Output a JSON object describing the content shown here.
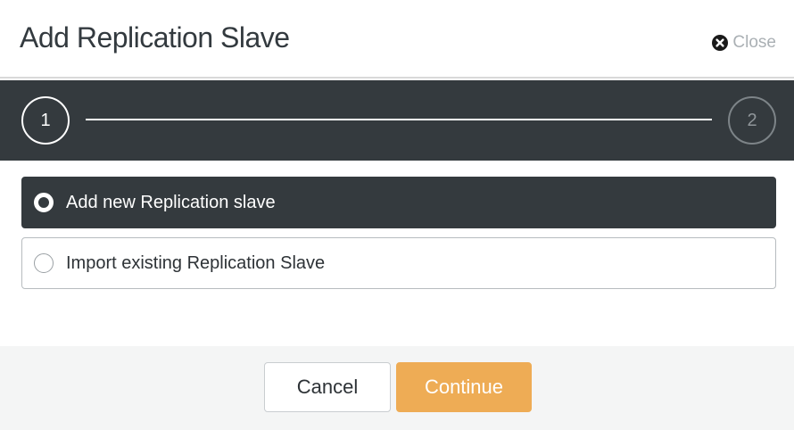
{
  "dialog": {
    "title": "Add Replication Slave",
    "close_label": "Close",
    "close_icon": "close-circle-icon"
  },
  "stepper": {
    "steps": [
      {
        "label": "1",
        "state": "active"
      },
      {
        "label": "2",
        "state": "inactive"
      }
    ]
  },
  "options": [
    {
      "label": "Add new Replication slave",
      "selected": true
    },
    {
      "label": "Import existing Replication Slave",
      "selected": false
    }
  ],
  "footer": {
    "cancel_label": "Cancel",
    "continue_label": "Continue"
  },
  "colors": {
    "dark": "#343a3e",
    "accent": "#eeac55",
    "footer_bg": "#f4f5f5"
  }
}
